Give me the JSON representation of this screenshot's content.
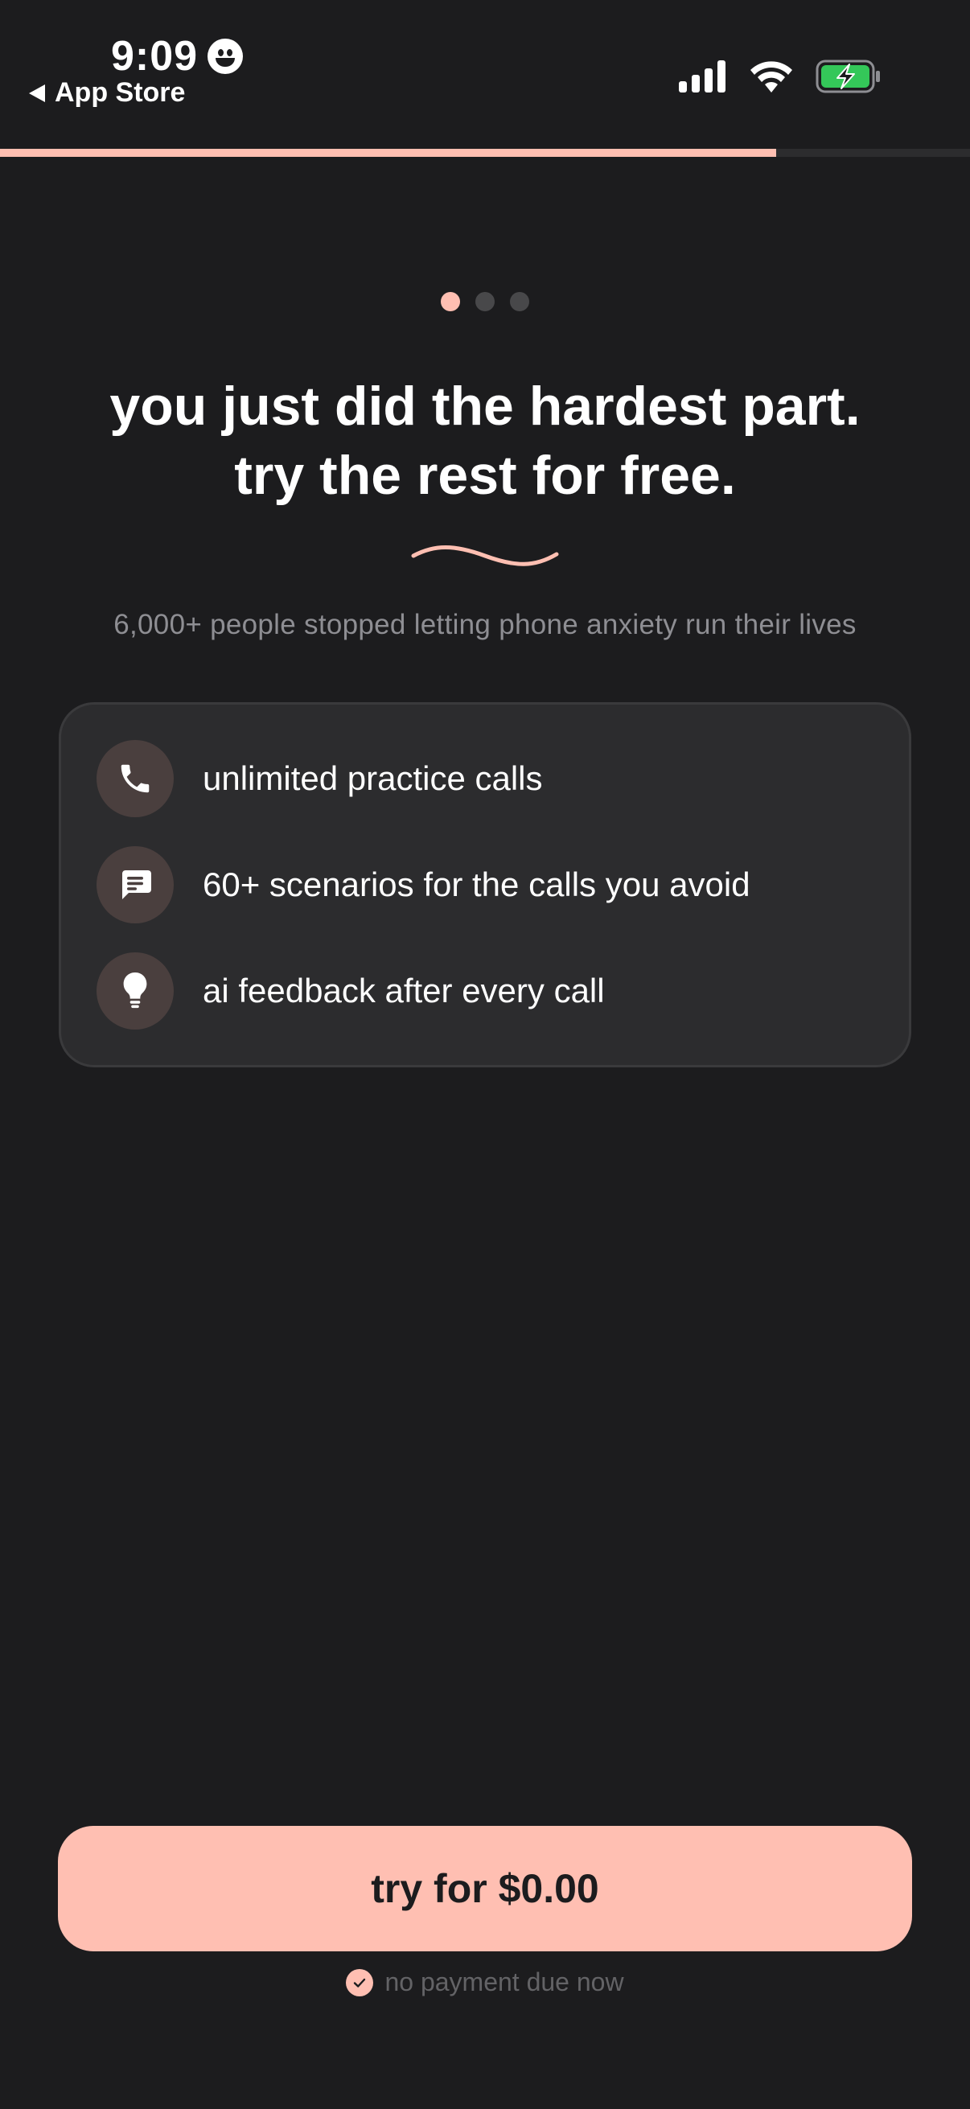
{
  "status_bar": {
    "time": "9:09",
    "back_label": "App Store"
  },
  "progress": {
    "fraction": 0.8
  },
  "pager": {
    "count": 3,
    "active_index": 0
  },
  "headline": {
    "line1": "you just did the hardest part.",
    "line2": "try the rest for free."
  },
  "subtitle": "6,000+ people stopped letting phone anxiety run their lives",
  "features": [
    {
      "icon": "phone-icon",
      "label": "unlimited practice calls"
    },
    {
      "icon": "chat-bubble-icon",
      "label": "60+ scenarios for the calls you avoid"
    },
    {
      "icon": "lightbulb-icon",
      "label": "ai feedback after every call"
    }
  ],
  "cta": {
    "label": "try for $0.00",
    "note": "no payment due now"
  },
  "colors": {
    "background": "#1c1c1e",
    "accent": "#ffbfb2",
    "card": "#2c2c2e",
    "battery": "#34c759"
  }
}
